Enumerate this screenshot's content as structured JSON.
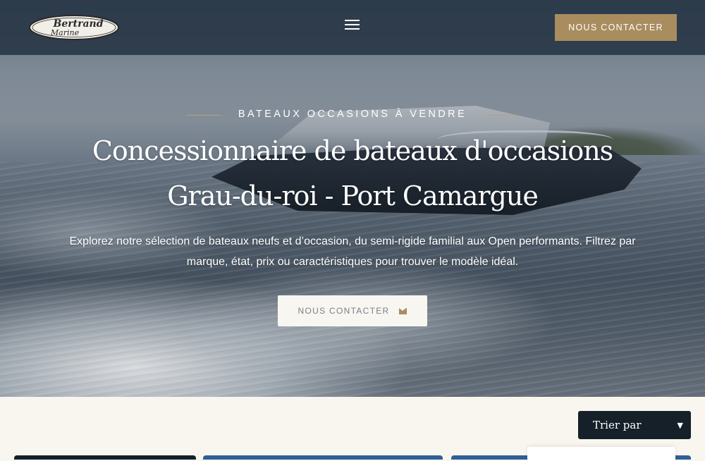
{
  "header": {
    "logo_text": "Bertrand Marine",
    "menu_icon": "hamburger-menu-icon",
    "cta_label": "NOUS CONTACTER",
    "cta_color": "#a98d5f",
    "background": "#263444"
  },
  "hero": {
    "eyebrow": "BATEAUX OCCASIONS À VENDRE",
    "title_line1": "Concessionnaire de bateaux d'occasions",
    "title_line2": "Grau-du-roi - Port Camargue",
    "intro": "Explorez notre sélection de bateaux neufs et d’occasion, du semi-rigide familial aux Open performants. Filtrez par marque, état, prix ou caractéristiques pour trouver le modèle idéal.",
    "cta_label": "NOUS CONTACTER",
    "cta_icon": "envelope-icon"
  },
  "listing": {
    "sort_label": "Trier par",
    "sort_icon": "chevron-down-icon"
  }
}
